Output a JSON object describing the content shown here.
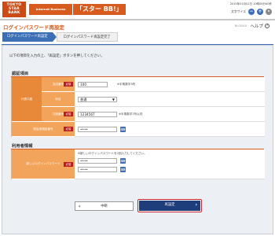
{
  "header": {
    "logo_lines": [
      "TOKYO",
      "STAR",
      "BANK"
    ],
    "service": "Internet Business Banking",
    "brand": "「スター BB!」",
    "last_login": "2010年01月01日 10時00分00秒",
    "size_label": "文字サイズ",
    "size_minus": "−",
    "size_plus": "+",
    "size_default": "•"
  },
  "title": {
    "page_title": "ログインパスワード再設定",
    "screen_id": "BLGI040",
    "help_label": "ヘルプ",
    "help_icon": "?"
  },
  "steps": [
    {
      "label": "ログインパスワード再設定"
    },
    {
      "label": "ログインパスワード再設定完了"
    }
  ],
  "intro": "以下の項目を入力の上、「再設定」ボタンを押してください。",
  "auth": {
    "title": "認証項目",
    "group_label": "代表口座",
    "required": "必須",
    "rows": [
      {
        "label": "支店番号",
        "value": "100",
        "note": "※半角数字3桁"
      },
      {
        "label": "科目",
        "value": "普通",
        "arrow": "▼"
      },
      {
        "label": "口座番号",
        "value": "1234567",
        "note": "※半角数字7桁以内"
      }
    ],
    "pin": {
      "label": "照会用暗証番号",
      "value": "••••"
    }
  },
  "user": {
    "title": "利用者情報",
    "pw_label": "新しいログインパスワード",
    "pw_note": "※新しいログインパスワードを2回入力してください。",
    "pw_value1": "••••",
    "pw_value2": "••••",
    "pw_hint": "※半角英数字"
  },
  "buttons": {
    "back": "中断",
    "back_arrow": "‹",
    "next": "再設定",
    "next_arrow": "›"
  },
  "colors": {
    "accent_orange": "#d85a1c",
    "label_orange": "#f2a45a",
    "navy": "#1e3d7b",
    "step_blue": "#3d6fb6",
    "required_red": "#b91e1e"
  }
}
